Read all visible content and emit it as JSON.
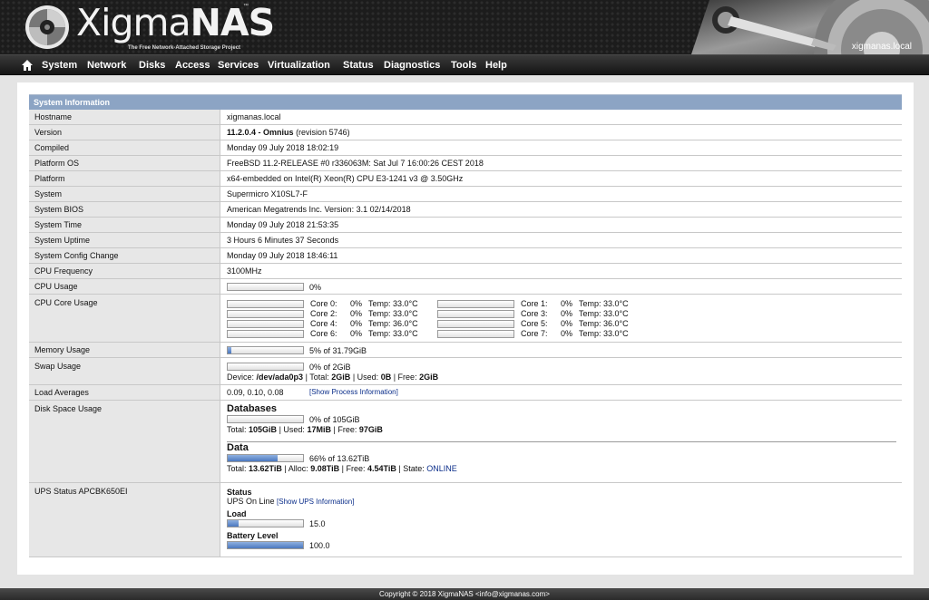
{
  "brand": {
    "name_a": "Xigma",
    "name_b": "NAS",
    "tm": "™",
    "tagline": "The Free Network-Attached Storage Project",
    "host": "xigmanas.local"
  },
  "nav": [
    "System",
    "Network",
    "Disks",
    "Access",
    "Services",
    "Virtualization",
    "Status",
    "Diagnostics",
    "Tools",
    "Help"
  ],
  "panel": {
    "title": "System Information",
    "rows": {
      "hostname": {
        "label": "Hostname",
        "value": "xigmanas.local"
      },
      "version": {
        "label": "Version",
        "value_bold": "11.2.0.4 - Omnius",
        "value_rest": "(revision 5746)"
      },
      "compiled": {
        "label": "Compiled",
        "value": "Monday 09 July 2018 18:02:19"
      },
      "platform_os": {
        "label": "Platform OS",
        "value": "FreeBSD 11.2-RELEASE #0 r336063M: Sat Jul 7 16:00:26 CEST 2018"
      },
      "platform": {
        "label": "Platform",
        "value": "x64-embedded on Intel(R) Xeon(R) CPU E3-1241 v3 @ 3.50GHz"
      },
      "system": {
        "label": "System",
        "value": "Supermicro X10SL7-F"
      },
      "bios": {
        "label": "System BIOS",
        "value": "American Megatrends Inc. Version: 3.1 02/14/2018"
      },
      "time": {
        "label": "System Time",
        "value": "Monday 09 July 2018 21:53:35"
      },
      "uptime": {
        "label": "System Uptime",
        "value": "3 Hours 6 Minutes 37 Seconds"
      },
      "config_change": {
        "label": "System Config Change",
        "value": "Monday 09 July 2018 18:46:11"
      },
      "cpu_freq": {
        "label": "CPU Frequency",
        "value": "3100MHz"
      },
      "cpu_usage": {
        "label": "CPU Usage",
        "value": "0%",
        "fraction": 0
      },
      "cpu_core": {
        "label": "CPU Core Usage"
      },
      "memory": {
        "label": "Memory Usage",
        "value": "5% of 31.79GiB",
        "fraction": 0.05
      },
      "swap": {
        "label": "Swap Usage",
        "value": "0% of 2GiB",
        "fraction": 0,
        "device_label": "Device:",
        "device": "/dev/ada0p3",
        "total_label": "| Total:",
        "total": "2GiB",
        "used_label": "| Used:",
        "used": "0B",
        "free_label": "| Free:",
        "free": "2GiB"
      },
      "load": {
        "label": "Load Averages",
        "value": "0.09, 0.10, 0.08",
        "link": "[Show Process Information]"
      },
      "disk": {
        "label": "Disk Space Usage"
      },
      "ups": {
        "label": "UPS Status APCBK650EI"
      }
    }
  },
  "cores": [
    {
      "name": "Core 0:",
      "pct": "0%",
      "temp": "Temp:  33.0°C"
    },
    {
      "name": "Core 1:",
      "pct": "0%",
      "temp": "Temp:  33.0°C"
    },
    {
      "name": "Core 2:",
      "pct": "0%",
      "temp": "Temp:  33.0°C"
    },
    {
      "name": "Core 3:",
      "pct": "0%",
      "temp": "Temp:  33.0°C"
    },
    {
      "name": "Core 4:",
      "pct": "0%",
      "temp": "Temp:  36.0°C"
    },
    {
      "name": "Core 5:",
      "pct": "0%",
      "temp": "Temp:  36.0°C"
    },
    {
      "name": "Core 6:",
      "pct": "0%",
      "temp": "Temp:  33.0°C"
    },
    {
      "name": "Core 7:",
      "pct": "0%",
      "temp": "Temp:  33.0°C"
    }
  ],
  "disks": {
    "databases": {
      "name": "Databases",
      "value": "0% of 105GiB",
      "fraction": 0,
      "total_label": "Total:",
      "total": "105GiB",
      "used_label": "| Used:",
      "used": "17MiB",
      "free_label": "| Free:",
      "free": "97GiB"
    },
    "data": {
      "name": "Data",
      "value": "66% of 13.62TiB",
      "fraction": 0.66,
      "total_label": "Total:",
      "total": "13.62TiB",
      "alloc_label": "| Alloc:",
      "alloc": "9.08TiB",
      "free_label": "| Free:",
      "free": "4.54TiB",
      "state_label": "| State:",
      "state": "ONLINE"
    }
  },
  "ups": {
    "status_title": "Status",
    "status_value": "UPS On Line",
    "status_link": "[Show UPS Information]",
    "load_title": "Load",
    "load_value": "15.0",
    "load_fraction": 0.15,
    "battery_title": "Battery Level",
    "battery_value": "100.0",
    "battery_fraction": 1.0
  },
  "footer": "Copyright © 2018 XigmaNAS <info@xigmanas.com>",
  "colors": {
    "accent": "#8ca4c4",
    "bar_fill": "#4b78bf",
    "link": "#0b2e8a"
  }
}
